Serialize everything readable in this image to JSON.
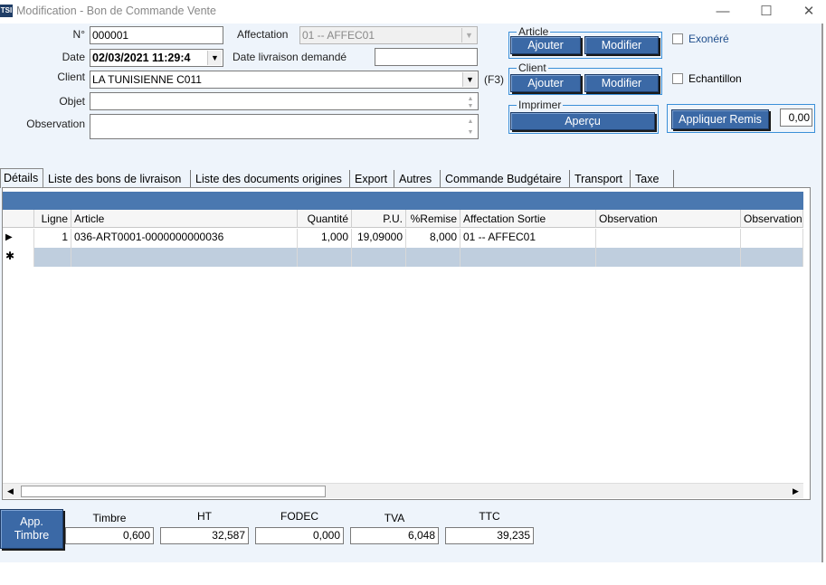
{
  "window": {
    "title": "Modification - Bon de Commande Vente",
    "icon_label": "TSI",
    "controls": {
      "minimize": "—",
      "maximize": "☐",
      "close": "✕"
    }
  },
  "form": {
    "numero": {
      "label": "N°",
      "value": "000001"
    },
    "date": {
      "label": "Date",
      "value": "02/03/2021 11:29:4"
    },
    "client": {
      "label": "Client",
      "value": "LA TUNISIENNE  C011",
      "shortcut": "(F3)"
    },
    "objet": {
      "label": "Objet",
      "value": ""
    },
    "observation": {
      "label": "Observation",
      "value": ""
    },
    "affectation": {
      "label": "Affectation",
      "value": "01 -- AFFEC01"
    },
    "date_livraison": {
      "label": "Date livraison demandé",
      "value": ""
    }
  },
  "groups": {
    "article": {
      "title": "Article",
      "ajouter": "Ajouter",
      "modifier": "Modifier"
    },
    "client": {
      "title": "Client",
      "ajouter": "Ajouter",
      "modifier": "Modifier"
    },
    "imprimer": {
      "title": "Imprimer",
      "apercu": "Aperçu"
    }
  },
  "options": {
    "exonere": {
      "label": "Exonéré",
      "checked": false
    },
    "echantillon": {
      "label": "Echantillon",
      "checked": false
    }
  },
  "remise": {
    "button": "Appliquer Remis",
    "value": "0,00"
  },
  "tabs": [
    "Détails",
    "Liste des bons de livraison",
    "Liste des documents origines",
    "Export",
    "Autres",
    "Commande Budgétaire",
    "Transport",
    "Taxe"
  ],
  "grid": {
    "columns": [
      "Ligne",
      "Article",
      "Quantité",
      "P.U.",
      "%Remise",
      "Affectation Sortie",
      "Observation",
      "Observation"
    ],
    "rows": [
      {
        "marker": "▶",
        "ligne": "1",
        "article": "036-ART0001-0000000000036",
        "quantite": "1,000",
        "pu": "19,09000",
        "remise": "8,000",
        "affectation": "01 -- AFFEC01",
        "observation": "",
        "observation2": ""
      }
    ],
    "new_row_marker": "✱"
  },
  "scrollbar": {
    "left": "◀",
    "right": "▶"
  },
  "footer": {
    "app_timbre": {
      "line1": "App.",
      "line2": "Timbre"
    },
    "totals": [
      {
        "label": "Timbre",
        "value": "0,600"
      },
      {
        "label": "HT",
        "value": "32,587"
      },
      {
        "label": "FODEC",
        "value": "0,000"
      },
      {
        "label": "TVA",
        "value": "6,048"
      },
      {
        "label": "TTC",
        "value": "39,235"
      }
    ]
  }
}
